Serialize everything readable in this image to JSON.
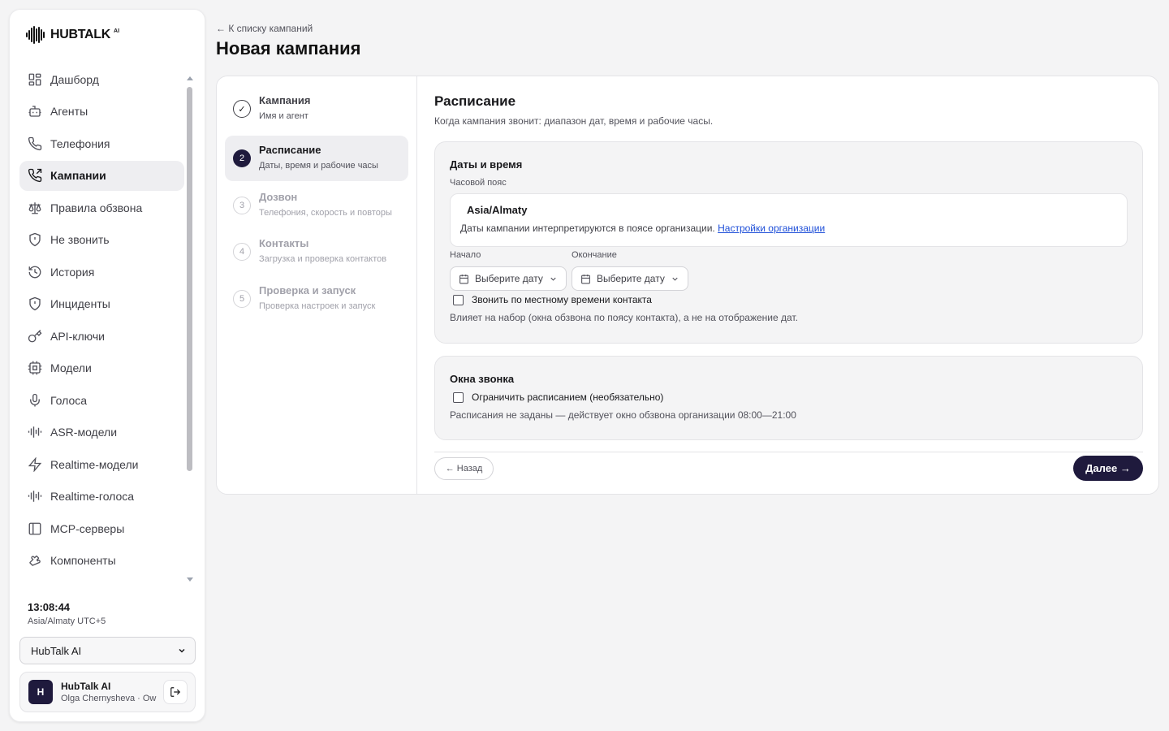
{
  "brand": {
    "name": "HUBTALK",
    "suffix": "AI"
  },
  "sidebar": {
    "items": [
      {
        "label": "Дашборд",
        "icon": "dashboard-icon"
      },
      {
        "label": "Агенты",
        "icon": "bot-icon"
      },
      {
        "label": "Телефония",
        "icon": "phone-icon"
      },
      {
        "label": "Кампании",
        "icon": "phone-outgoing-icon",
        "active": true
      },
      {
        "label": "Правила обзвона",
        "icon": "scale-icon"
      },
      {
        "label": "Не звонить",
        "icon": "shield-icon"
      },
      {
        "label": "История",
        "icon": "history-icon"
      },
      {
        "label": "Инциденты",
        "icon": "shield-alert-icon"
      },
      {
        "label": "API-ключи",
        "icon": "key-icon"
      },
      {
        "label": "Модели",
        "icon": "cpu-icon"
      },
      {
        "label": "Голоса",
        "icon": "mic-icon"
      },
      {
        "label": "ASR-модели",
        "icon": "audio-lines-icon"
      },
      {
        "label": "Realtime-модели",
        "icon": "zap-icon"
      },
      {
        "label": "Realtime-голоса",
        "icon": "audio-lines-icon"
      },
      {
        "label": "MCP-серверы",
        "icon": "panel-icon"
      },
      {
        "label": "Компоненты",
        "icon": "puzzle-icon"
      }
    ],
    "clock": "13:08:44",
    "timezone": "Asia/Almaty UTC+5",
    "org_select": "HubTalk AI",
    "user": {
      "initial": "H",
      "name": "HubTalk AI",
      "sub": "Olga Chernysheva · Owner"
    }
  },
  "header": {
    "back_link": "← К списку кампаний",
    "title": "Новая кампания"
  },
  "steps": [
    {
      "num": "✓",
      "title": "Кампания",
      "sub": "Имя и агент",
      "state": "done"
    },
    {
      "num": "2",
      "title": "Расписание",
      "sub": "Даты, время и рабочие часы",
      "state": "current"
    },
    {
      "num": "3",
      "title": "Дозвон",
      "sub": "Телефония, скорость и повторы",
      "state": "future"
    },
    {
      "num": "4",
      "title": "Контакты",
      "sub": "Загрузка и проверка контактов",
      "state": "future"
    },
    {
      "num": "5",
      "title": "Проверка и запуск",
      "sub": "Проверка настроек и запуск",
      "state": "future"
    }
  ],
  "schedule": {
    "title": "Расписание",
    "subtitle": "Когда кампания звонит: диапазон дат, время и рабочие часы.",
    "dates": {
      "title": "Даты и время",
      "tz_label": "Часовой пояс",
      "tz_value": "Asia/Almaty",
      "tz_note": "Даты кампании интерпретируются в поясе организации.",
      "tz_link": "Настройки организации",
      "start_label": "Начало",
      "end_label": "Окончание",
      "start_placeholder": "Выберите дату",
      "end_placeholder": "Выберите дату",
      "local_time_checkbox": "Звонить по местному времени контакта",
      "local_time_hint": "Влияет на набор (окна обзвона по поясу контакта), а не на отображение дат."
    },
    "windows": {
      "title": "Окна звонка",
      "limit_checkbox": "Ограничить расписанием (необязательно)",
      "hint": "Расписания не заданы — действует окно обзвона организации 08:00—21:00"
    },
    "back_button": "← Назад",
    "next_button": "Далее →"
  },
  "colors": {
    "accent": "#1f1a3d",
    "link": "#1d4ed8",
    "page_bg": "#f4f4f5"
  }
}
